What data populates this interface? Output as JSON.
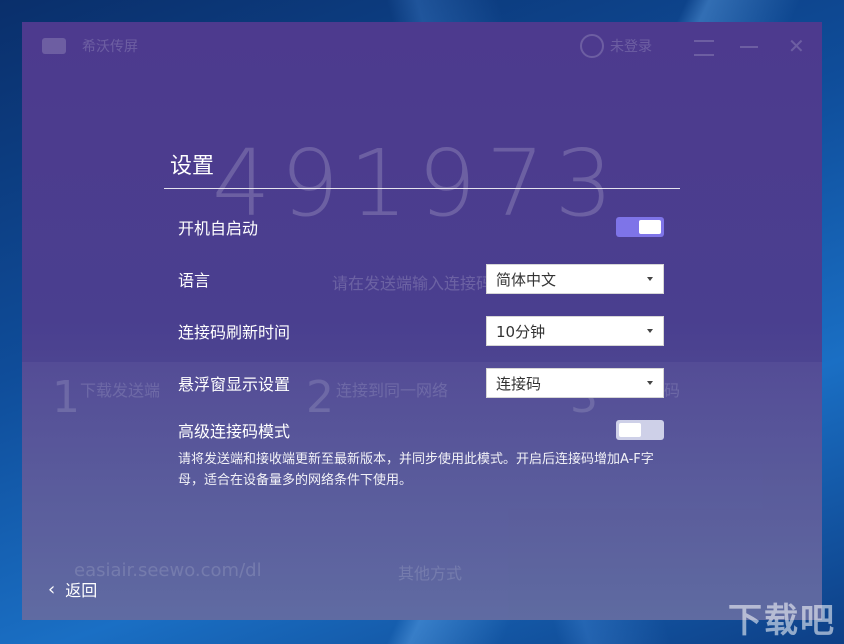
{
  "window": {
    "app_title": "希沃传屏",
    "login_label": "未登录",
    "connect_code": "491973",
    "connect_hint": "请在发送端输入连接码",
    "steps": [
      {
        "num": "1",
        "title": "下载发送端"
      },
      {
        "num": "2",
        "title": "连接到同一网络"
      },
      {
        "num": "3",
        "title": "输入连接码"
      }
    ],
    "download_link": "easiair.seewo.com/dl",
    "other_label": "其他方式"
  },
  "settings": {
    "title": "设置",
    "autostart": {
      "label": "开机自启动",
      "enabled": true
    },
    "language": {
      "label": "语言",
      "value": "简体中文"
    },
    "refresh_time": {
      "label": "连接码刷新时间",
      "value": "10分钟"
    },
    "float_window": {
      "label": "悬浮窗显示设置",
      "value": "连接码"
    },
    "advanced_mode": {
      "label": "高级连接码模式",
      "enabled": false,
      "note": "请将发送端和接收端更新至最新版本，并同步使用此模式。开启后连接码增加A-F字母，适合在设备量多的网络条件下使用。"
    },
    "back_label": "返回"
  },
  "watermark": "下载吧",
  "colors": {
    "toggle_on": "#7e74e8",
    "toggle_off": "#ced0e8",
    "panel_top": "#4d3a8e",
    "panel_bottom": "#58649d"
  },
  "icons": [
    "chevron-left-icon",
    "chevron-down-icon",
    "user-icon",
    "menu-icon",
    "minimize-icon",
    "close-icon"
  ]
}
